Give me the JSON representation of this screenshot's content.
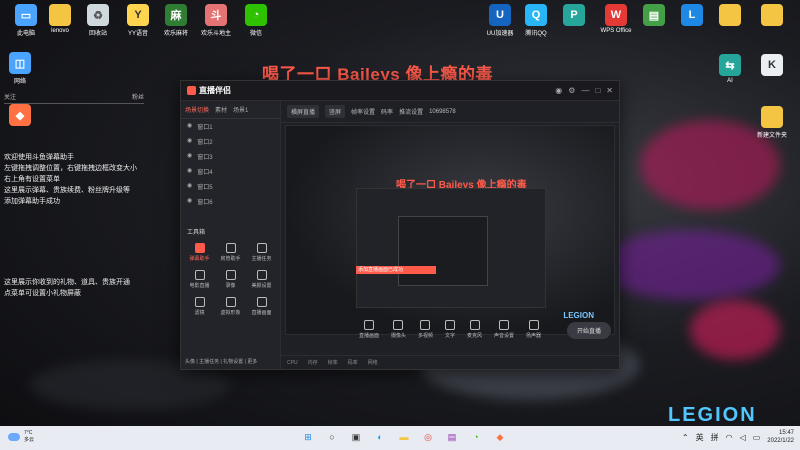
{
  "overlay_title": "喝了一口 Baileys 像上瘾的毒",
  "desktop_icons": [
    {
      "label": "此电脑",
      "icon": "computer-icon",
      "color": "#4aa3ff"
    },
    {
      "label": "lenovo",
      "icon": "folder-icon",
      "color": "#f4c542"
    },
    {
      "label": "回收站",
      "icon": "recycle-bin-icon",
      "color": "#cfd8dc"
    },
    {
      "label": "YY语音",
      "icon": "yy-icon",
      "color": "#ffd54f"
    },
    {
      "label": "欢乐麻将",
      "icon": "mahjong-icon",
      "color": "#2e7d32"
    },
    {
      "label": "欢乐斗地主",
      "icon": "doudizhu-icon",
      "color": "#e57373"
    },
    {
      "label": "微信",
      "icon": "wechat-icon",
      "color": "#2dc100"
    },
    {
      "label": "网络",
      "icon": "network-icon",
      "color": "#4aa3ff"
    },
    {
      "label": "",
      "icon": "app-icon",
      "color": "#ff7043"
    }
  ],
  "desktop_icons_right": [
    {
      "label": "UU加速器",
      "icon": "uu-icon",
      "color": "#1565c0"
    },
    {
      "label": "腾讯QQ",
      "icon": "qq-icon",
      "color": "#29b6f6"
    },
    {
      "label": "",
      "icon": "pb-icon",
      "color": "#26a69a"
    },
    {
      "label": "WPS Office",
      "icon": "wps-icon",
      "color": "#e53935"
    },
    {
      "label": "",
      "icon": "doc-icon",
      "color": "#43a047"
    },
    {
      "label": "",
      "icon": "l-icon",
      "color": "#1e88e5"
    },
    {
      "label": "",
      "icon": "folder-icon",
      "color": "#f4c542"
    },
    {
      "label": "",
      "icon": "folder-icon",
      "color": "#f4c542"
    },
    {
      "label": "AI",
      "icon": "ai-icon",
      "color": "#26a69a"
    },
    {
      "label": "K",
      "icon": "doc-icon",
      "color": "#eceff1"
    },
    {
      "label": "新建文件夹",
      "icon": "folder-icon",
      "color": "#f4c542"
    }
  ],
  "chat_widget": {
    "tabs": [
      "",
      "关注",
      "",
      "粉丝"
    ],
    "lines": [
      "欢迎使用斗鱼弹幕助手",
      "左键拖拽调整位置，右键拖拽边框改变大小",
      "右上角有设置菜单",
      "这里展示弹幕、贵族续费、粉丝牌升级等",
      "添加弹幕助手成功",
      "",
      "这里展示你收到的礼物、道具、贵族开通",
      "点菜单可设置小礼物屏蔽"
    ]
  },
  "app": {
    "name": "直播伴侣",
    "left_tabs": [
      "场景切换",
      "素材",
      "场景1"
    ],
    "scenes": [
      "窗口1",
      "窗口2",
      "窗口3",
      "窗口4",
      "窗口5",
      "窗口6"
    ],
    "tools_title": "工具箱",
    "tools": [
      "弹幕助手",
      "房管助手",
      "主播任务",
      "电影直播",
      "录像",
      "美颜设置",
      "滤镜",
      "虚拟形象",
      "直播画面"
    ],
    "preview_tabs": [
      "横屏直播",
      "竖屏"
    ],
    "preview_info": [
      "帧率设置",
      "码率",
      "推流设置",
      "10698578"
    ],
    "preview_title": "喝了一口 Baileys 像上瘾的毒",
    "preview_banner": "添加直播画面已成功",
    "preview_logo": "LEGION",
    "bottom_tools": [
      "直播画面",
      "摄像头",
      "多视频",
      "文字",
      "麦克风",
      "声音设置",
      "扬声器"
    ],
    "start_button": "开始直播",
    "status": [
      "CPU",
      "内存",
      "帧率",
      "码率",
      "网络"
    ],
    "left_status": "头像 | 主播任务 | 礼物设置 | 更多"
  },
  "wallpaper_logo": "LEGION",
  "taskbar": {
    "weather_temp": "7°C",
    "weather_desc": "多云",
    "icons": [
      {
        "name": "windows-start-icon",
        "glyph": "⊞",
        "color": "#1e88e5"
      },
      {
        "name": "search-icon",
        "glyph": "○",
        "color": "#333"
      },
      {
        "name": "task-view-icon",
        "glyph": "▣",
        "color": "#333"
      },
      {
        "name": "edge-icon",
        "glyph": "◐",
        "color": "#0aa5e8"
      },
      {
        "name": "explorer-icon",
        "glyph": "▬",
        "color": "#f4c542"
      },
      {
        "name": "netease-music-icon",
        "glyph": "◎",
        "color": "#e53935"
      },
      {
        "name": "store-icon",
        "glyph": "▤",
        "color": "#8e24aa"
      },
      {
        "name": "wechat-icon",
        "glyph": "◔",
        "color": "#2dc100"
      },
      {
        "name": "live-companion-icon",
        "glyph": "◆",
        "color": "#ff7043"
      }
    ],
    "tray_lang": "英",
    "tray_ime": "拼",
    "time": "15:47",
    "date": "2022/1/22"
  }
}
